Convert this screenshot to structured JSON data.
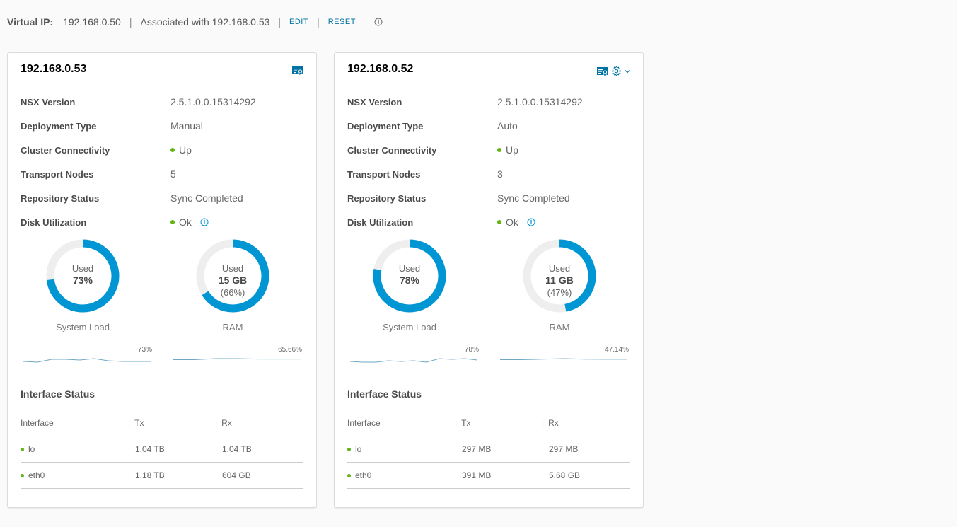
{
  "virtual_ip": {
    "label": "Virtual IP:",
    "ip": "192.168.0.50",
    "associated": "Associated with 192.168.0.53",
    "edit_label": "EDIT",
    "reset_label": "RESET",
    "info_icon": "info-icon"
  },
  "colors": {
    "accent": "#0095d3",
    "track": "#eeeeee",
    "status_ok": "#60b515",
    "link": "#0072a3",
    "sparkline": "#6fa8c7"
  },
  "property_labels": {
    "nsx_version": "NSX Version",
    "deployment_type": "Deployment Type",
    "cluster_connectivity": "Cluster Connectivity",
    "transport_nodes": "Transport Nodes",
    "repository_status": "Repository Status",
    "disk_utilization": "Disk Utilization"
  },
  "gauge_labels": {
    "used": "Used",
    "system_load": "System Load",
    "ram": "RAM"
  },
  "interface_section": {
    "title": "Interface Status",
    "columns": [
      "Interface",
      "Tx",
      "Rx"
    ]
  },
  "nodes": [
    {
      "ip": "192.168.0.53",
      "icons": [
        "certificate-icon"
      ],
      "nsx_version": "2.5.1.0.0.15314292",
      "deployment_type": "Manual",
      "cluster_connectivity": "Up",
      "transport_nodes": "5",
      "repository_status": "Sync Completed",
      "disk_utilization": "Ok",
      "system_load": {
        "percent": 73,
        "label": "73%"
      },
      "ram": {
        "percent": 66,
        "used": "15 GB",
        "pct_label": "(66%)"
      },
      "sparklines": {
        "system_load": {
          "label": "73%",
          "values": [
            70,
            69,
            73,
            73,
            72,
            74,
            71,
            70,
            70,
            70
          ]
        },
        "ram": {
          "label": "65.66%",
          "values": [
            65.6,
            65.6,
            65.7,
            65.7,
            65.66,
            65.66,
            65.66
          ]
        }
      },
      "interfaces": [
        {
          "name": "lo",
          "tx": "1.04 TB",
          "rx": "1.04 TB"
        },
        {
          "name": "eth0",
          "tx": "1.18 TB",
          "rx": "604 GB"
        }
      ]
    },
    {
      "ip": "192.168.0.52",
      "icons": [
        "certificate-icon",
        "gear-icon",
        "chevron-down-icon"
      ],
      "nsx_version": "2.5.1.0.0.15314292",
      "deployment_type": "Auto",
      "cluster_connectivity": "Up",
      "transport_nodes": "3",
      "repository_status": "Sync Completed",
      "disk_utilization": "Ok",
      "system_load": {
        "percent": 78,
        "label": "78%"
      },
      "ram": {
        "percent": 47,
        "used": "11 GB",
        "pct_label": "(47%)"
      },
      "sparklines": {
        "system_load": {
          "label": "78%",
          "values": [
            74,
            73,
            73,
            75,
            74,
            75,
            73,
            78,
            77,
            78,
            76
          ]
        },
        "ram": {
          "label": "47.14%",
          "values": [
            47.1,
            47.1,
            47.15,
            47.2,
            47.15,
            47.14,
            47.14
          ]
        }
      },
      "interfaces": [
        {
          "name": "lo",
          "tx": "297 MB",
          "rx": "297 MB"
        },
        {
          "name": "eth0",
          "tx": "391 MB",
          "rx": "5.68 GB"
        }
      ]
    }
  ]
}
